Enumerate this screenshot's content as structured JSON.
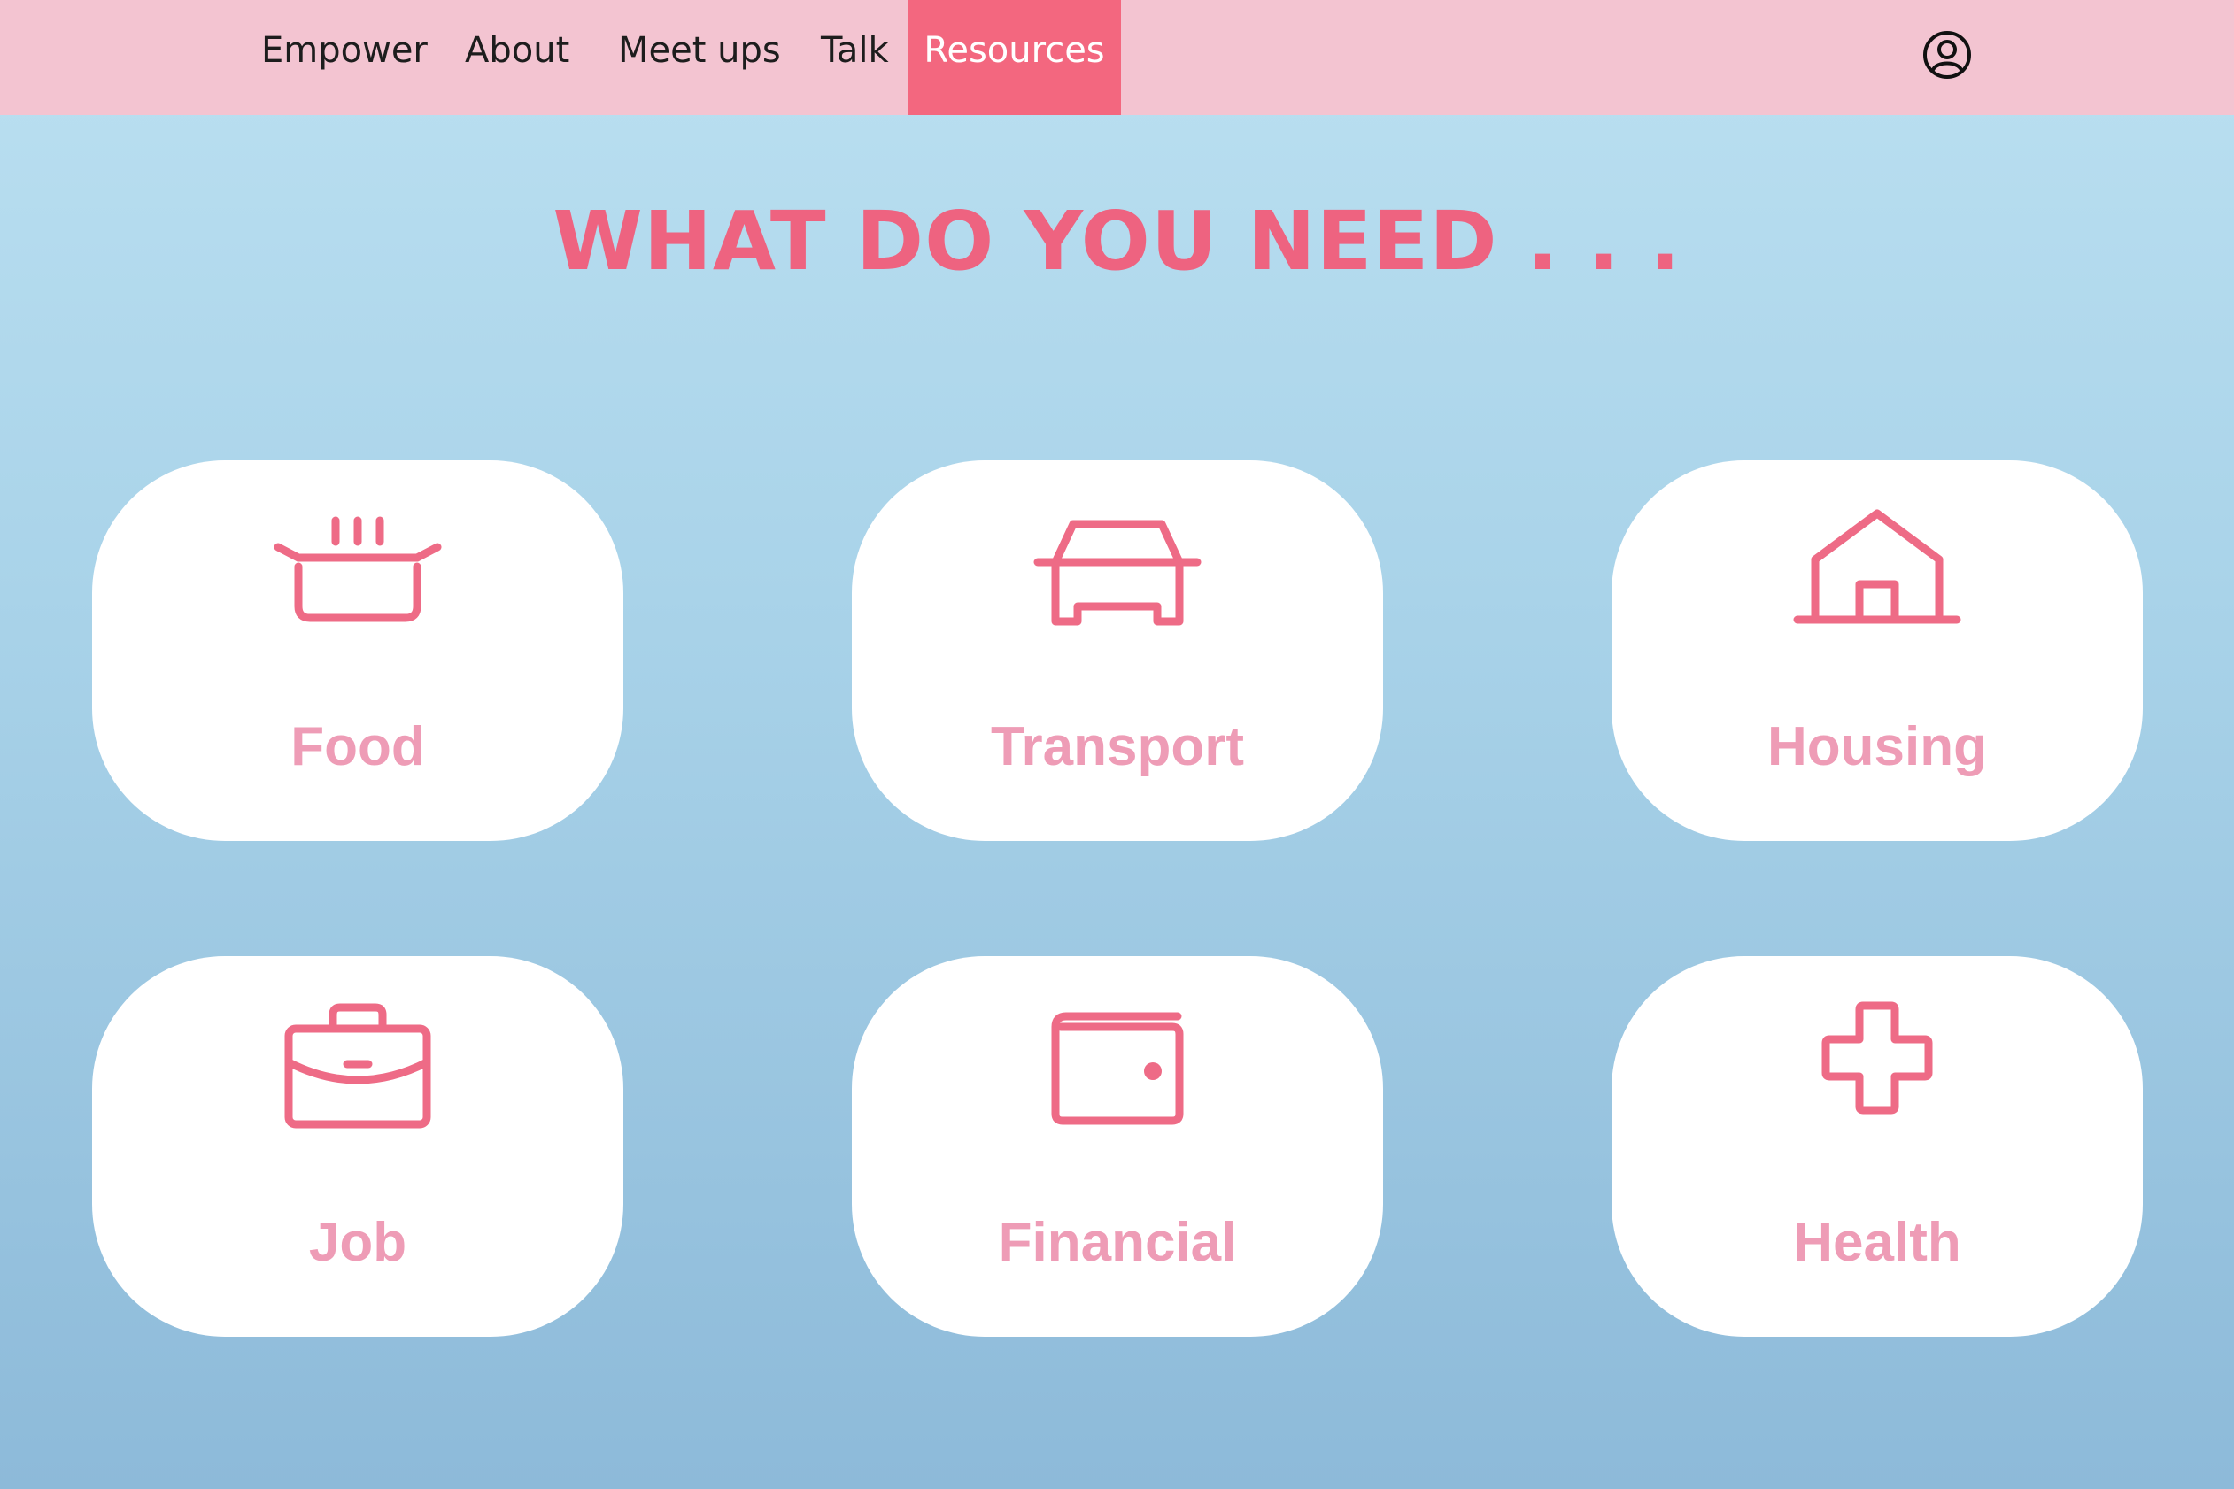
{
  "nav": {
    "items": [
      {
        "label": "Empower"
      },
      {
        "label": "About"
      },
      {
        "label": "Meet ups"
      },
      {
        "label": "Talk"
      },
      {
        "label": "Resources",
        "active": true
      }
    ],
    "user_icon": "user-circle-icon"
  },
  "main": {
    "headline": "WHAT DO YOU NEED . . ."
  },
  "cards": [
    {
      "label": "Food",
      "icon": "cooking-pot-icon"
    },
    {
      "label": "Transport",
      "icon": "car-icon"
    },
    {
      "label": "Housing",
      "icon": "house-icon"
    },
    {
      "label": "Job",
      "icon": "briefcase-icon"
    },
    {
      "label": "Financial",
      "icon": "wallet-icon"
    },
    {
      "label": "Health",
      "icon": "medical-cross-icon"
    }
  ],
  "colors": {
    "nav_bg": "#f3c4d1",
    "nav_active": "#f3677f",
    "headline": "#ee6380",
    "icon": "#ee6b86",
    "card_label": "#ee9cb6",
    "bg_top": "#bbe0f1",
    "bg_bottom": "#8dbad9"
  }
}
